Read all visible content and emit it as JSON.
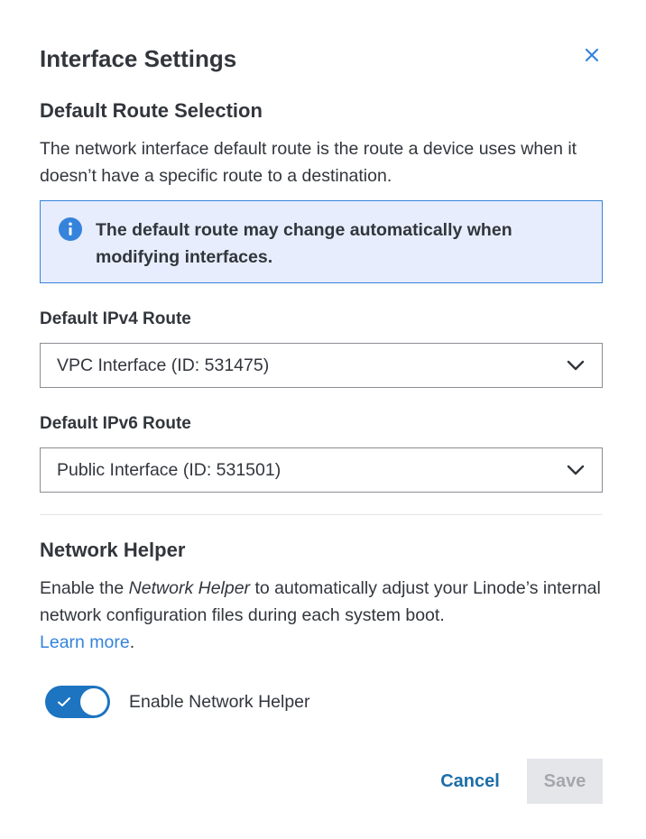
{
  "dialog": {
    "title": "Interface Settings",
    "close_icon": "close-icon"
  },
  "default_route": {
    "heading": "Default Route Selection",
    "description": "The network interface default route is the route a device uses when it doesn’t have a specific route to a destination.",
    "notice": {
      "icon": "info-icon",
      "text": "The default route may change automatically when modifying interfaces."
    },
    "ipv4": {
      "label": "Default IPv4 Route",
      "selected": "VPC Interface (ID: 531475)"
    },
    "ipv6": {
      "label": "Default IPv6 Route",
      "selected": "Public Interface (ID: 531501)"
    }
  },
  "network_helper": {
    "heading": "Network Helper",
    "description_before": "Enable the ",
    "description_emphasis": "Network Helper",
    "description_after": " to automatically adjust your Linode’s internal network configuration files during each system boot.",
    "learn_more": "Learn more",
    "learn_more_suffix": ".",
    "toggle_label": "Enable Network Helper",
    "toggle_on": true
  },
  "actions": {
    "cancel": "Cancel",
    "save": "Save"
  },
  "colors": {
    "accent": "#3683dc",
    "toggle_on": "#1d74c1",
    "notice_bg": "#e7edfc",
    "save_disabled_bg": "#e5e6ea"
  }
}
